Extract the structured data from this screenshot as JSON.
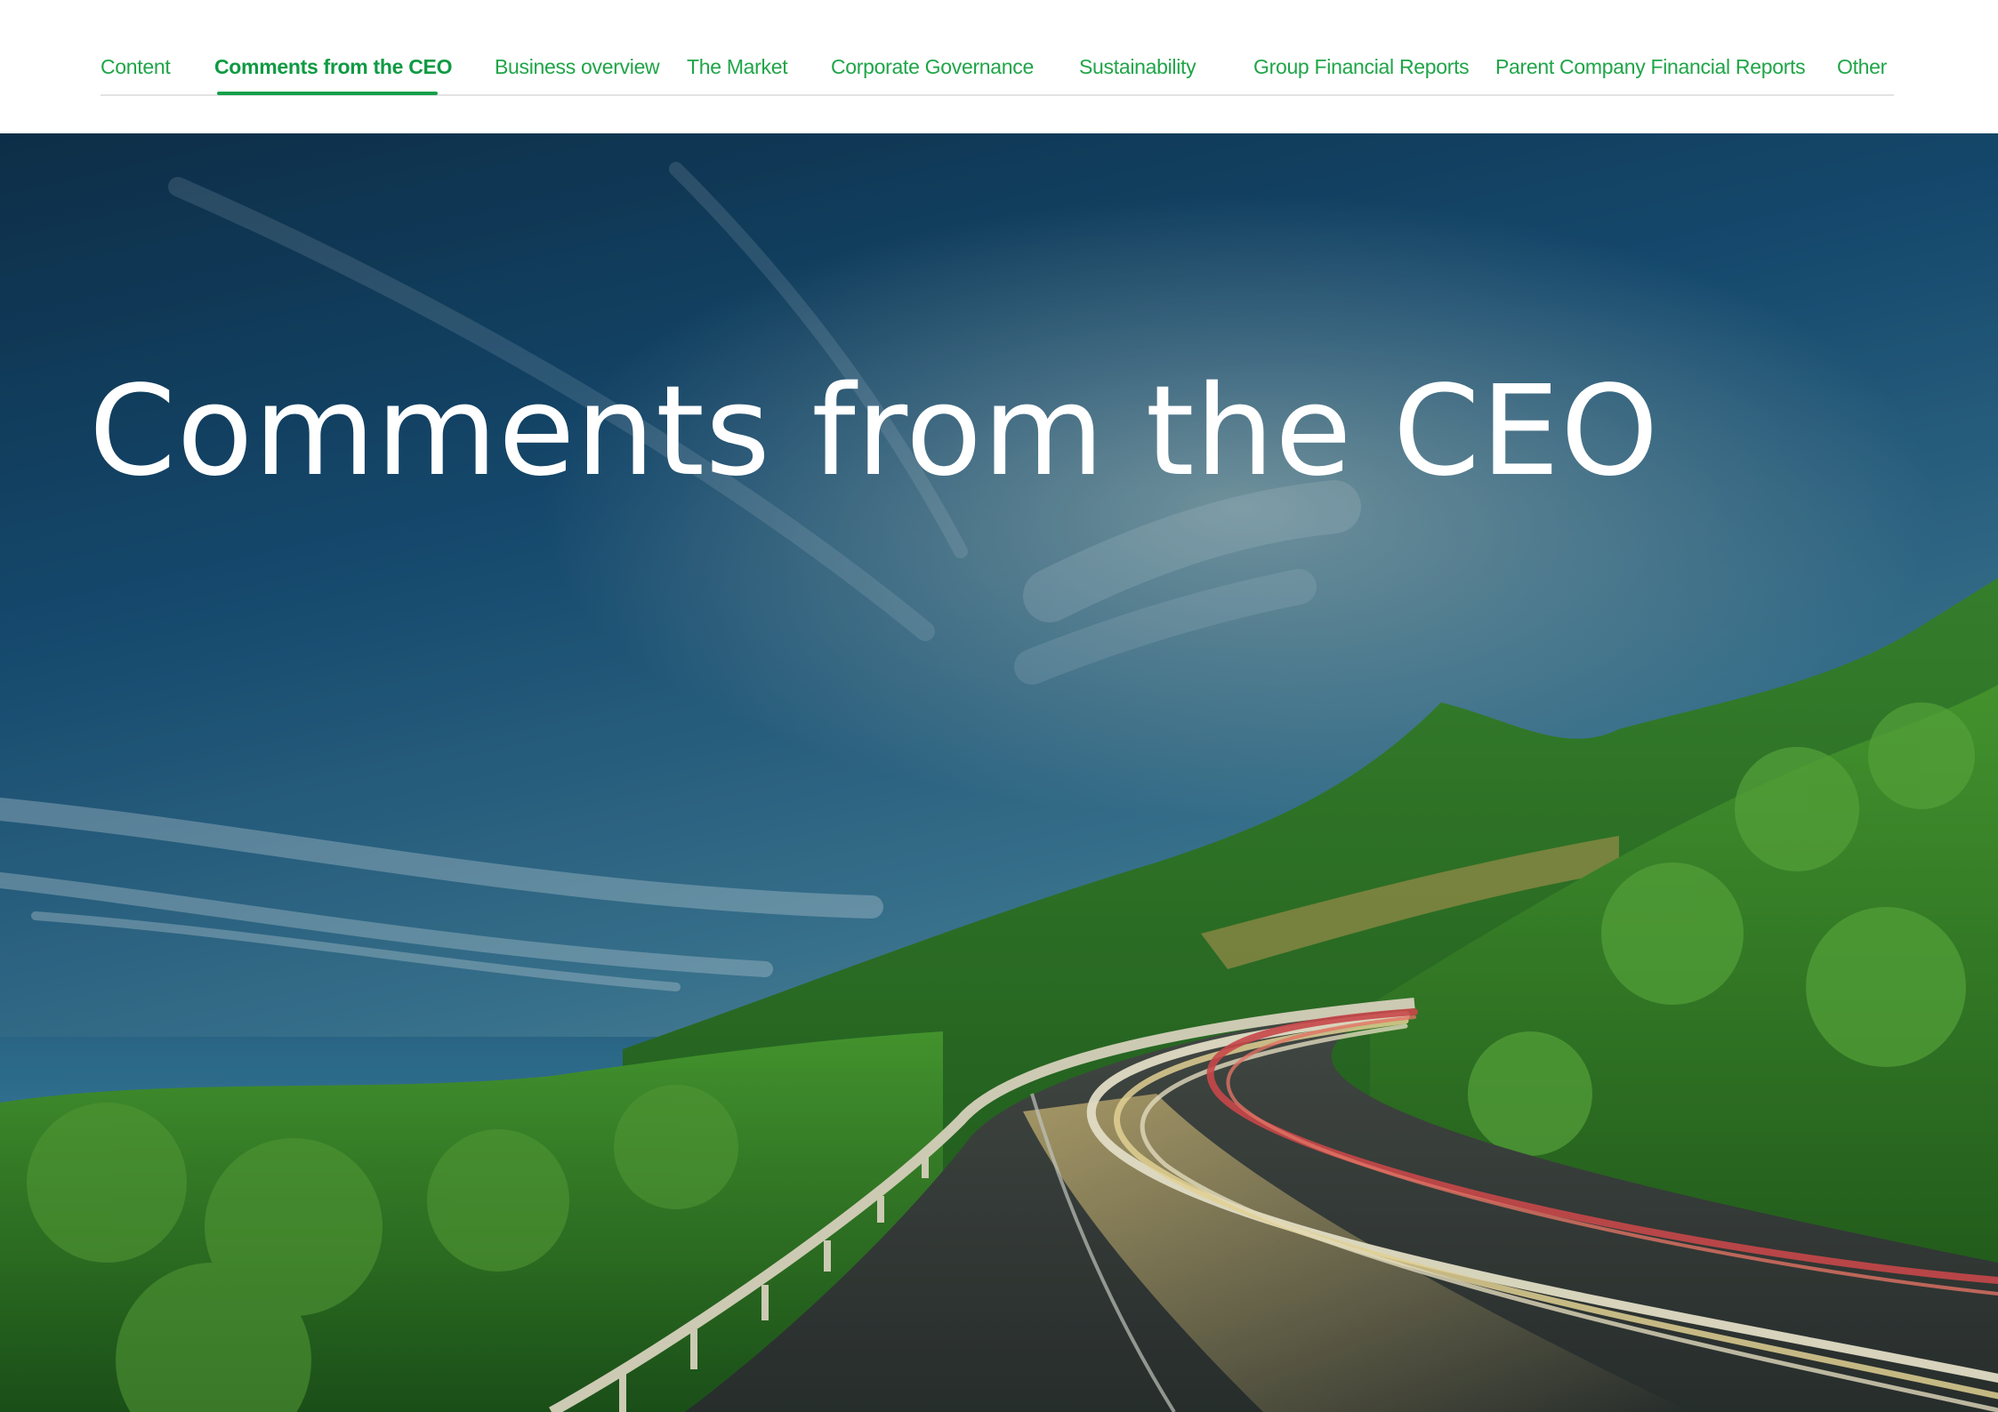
{
  "nav": {
    "items": [
      {
        "label": "Content",
        "active": false
      },
      {
        "label": "Comments from the CEO",
        "active": true
      },
      {
        "label": "Business overview",
        "active": false
      },
      {
        "label": "The Market",
        "active": false
      },
      {
        "label": "Corporate Governance",
        "active": false
      },
      {
        "label": "Sustainability",
        "active": false
      },
      {
        "label": "Group Financial Reports",
        "active": false
      },
      {
        "label": "Parent Company Financial Reports",
        "active": false
      },
      {
        "label": "Other",
        "active": false
      }
    ]
  },
  "hero": {
    "title": "Comments from the CEO",
    "image": "landscape-photo-mountain-road-light-trails"
  },
  "colors": {
    "accent": "#1fa548",
    "sky_top": "#0f3450",
    "title": "#ffffff"
  }
}
